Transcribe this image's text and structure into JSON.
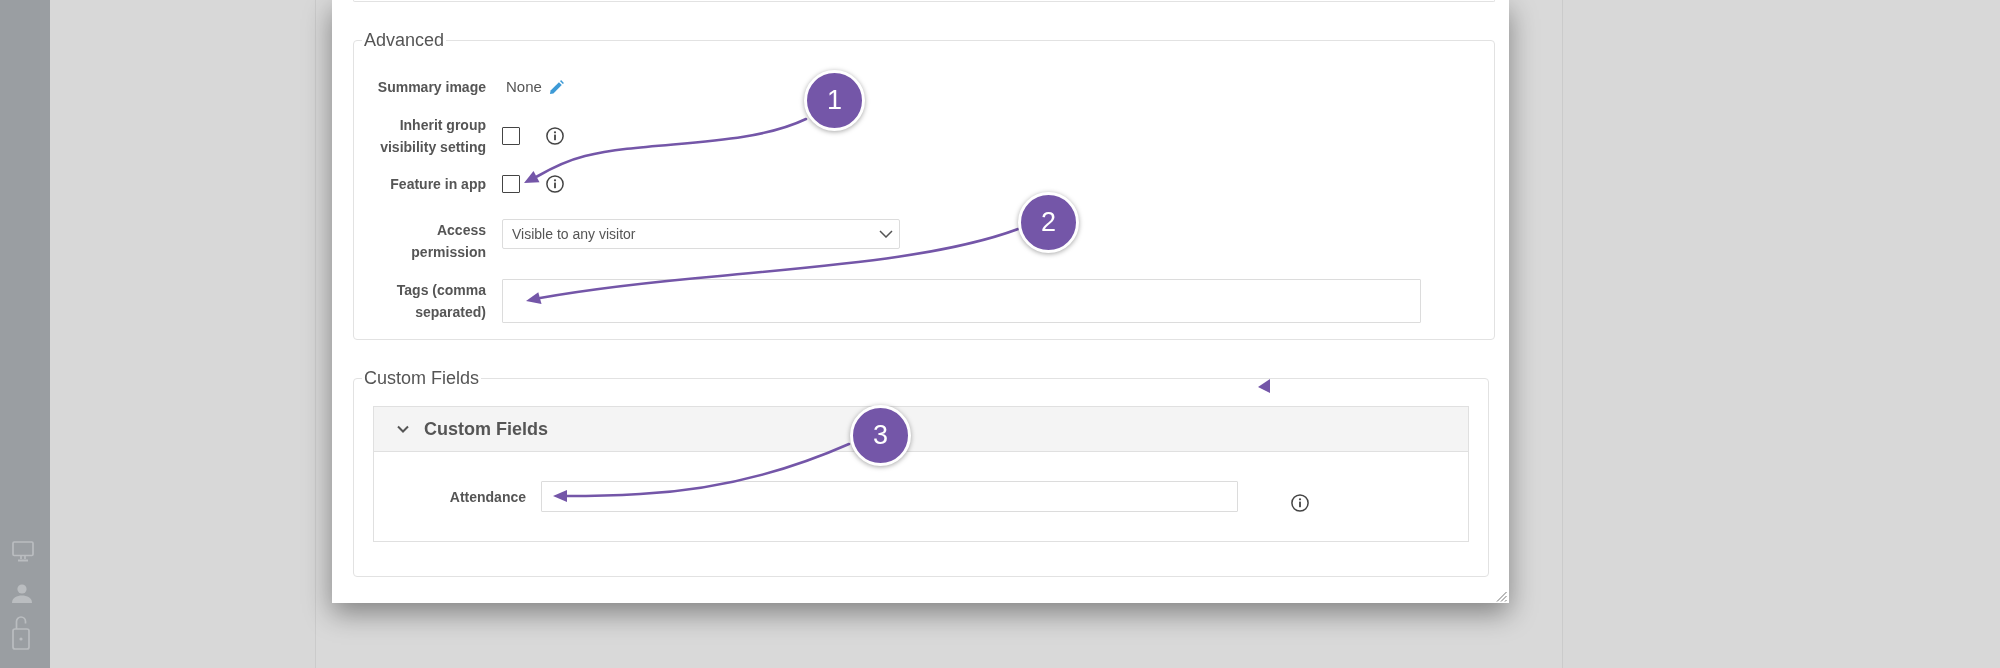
{
  "advanced": {
    "legend": "Advanced",
    "fields": [
      {
        "kind": "image",
        "label": "Summary image",
        "value": "None"
      },
      {
        "kind": "checkbox",
        "label": "Inherit group visibility setting",
        "checked": false
      },
      {
        "kind": "checkbox",
        "label": "Feature in app",
        "checked": false
      },
      {
        "kind": "select",
        "label": "Access permission",
        "value": "Visible to any visitor"
      },
      {
        "kind": "text",
        "label": "Tags (comma separated)"
      }
    ]
  },
  "custom_fields": {
    "legend": "Custom Fields",
    "panel": {
      "title": "Custom Fields",
      "expanded": true,
      "fields": [
        {
          "label": "Attendance"
        }
      ]
    }
  },
  "annotations": [
    {
      "label": "1"
    },
    {
      "label": "2"
    },
    {
      "label": "3"
    }
  ]
}
